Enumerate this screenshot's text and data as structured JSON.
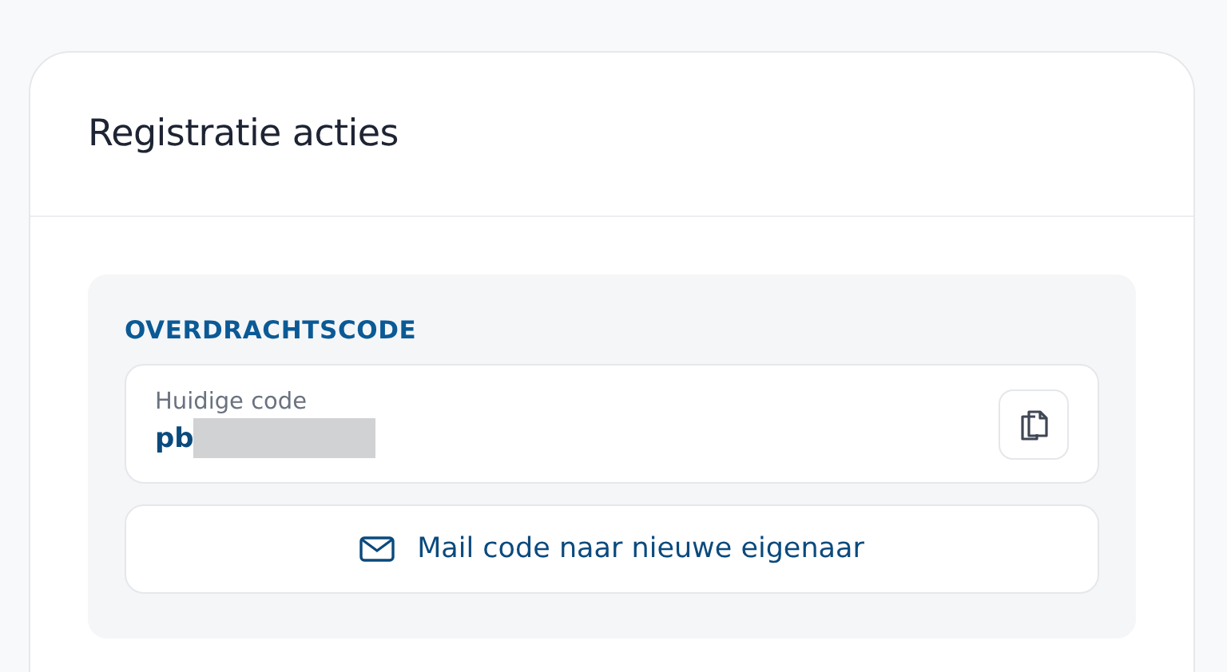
{
  "card": {
    "title": "Registratie acties"
  },
  "transfer_code": {
    "heading": "OVERDRACHTSCODE",
    "label": "Huidige code",
    "value": "pb",
    "redacted": true
  },
  "mail_button": {
    "label": "Mail code naar nieuwe eigenaar"
  }
}
